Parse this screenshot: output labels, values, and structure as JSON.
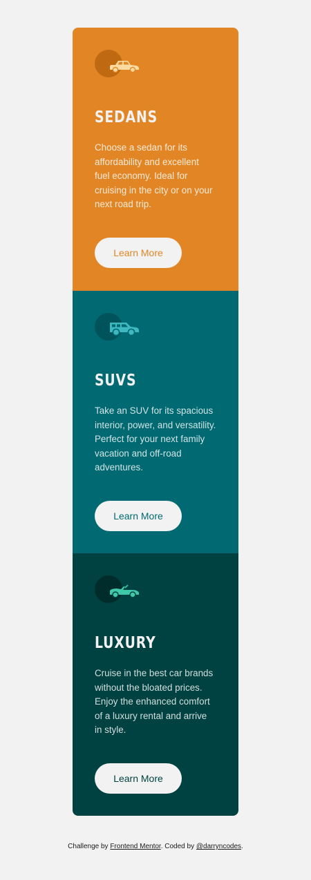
{
  "colors": {
    "background": "#f2f2f2",
    "sedans": "#e28625",
    "suvs": "#006971",
    "luxury": "#004241",
    "button_bg": "#f2f2f2"
  },
  "cards": [
    {
      "id": "sedans",
      "icon": "sedan-car-icon",
      "title": "SEDANS",
      "description": "Choose a sedan for its affordability and excellent fuel economy. Ideal for cruising in the city or on your next road trip.",
      "button_label": "Learn More"
    },
    {
      "id": "suvs",
      "icon": "suv-car-icon",
      "title": "SUVS",
      "description": "Take an SUV for its spacious interior, power, and versatility. Perfect for your next family vacation and off-road adventures.",
      "button_label": "Learn More"
    },
    {
      "id": "luxury",
      "icon": "luxury-car-icon",
      "title": "LUXURY",
      "description": "Cruise in the best car brands without the bloated prices. Enjoy the enhanced comfort of a luxury rental and arrive in style.",
      "button_label": "Learn More"
    }
  ],
  "footer": {
    "prefix": "Challenge by ",
    "link1": "Frontend Mentor",
    "middle": ". Coded by ",
    "link2": "@darryncodes",
    "suffix": "."
  }
}
